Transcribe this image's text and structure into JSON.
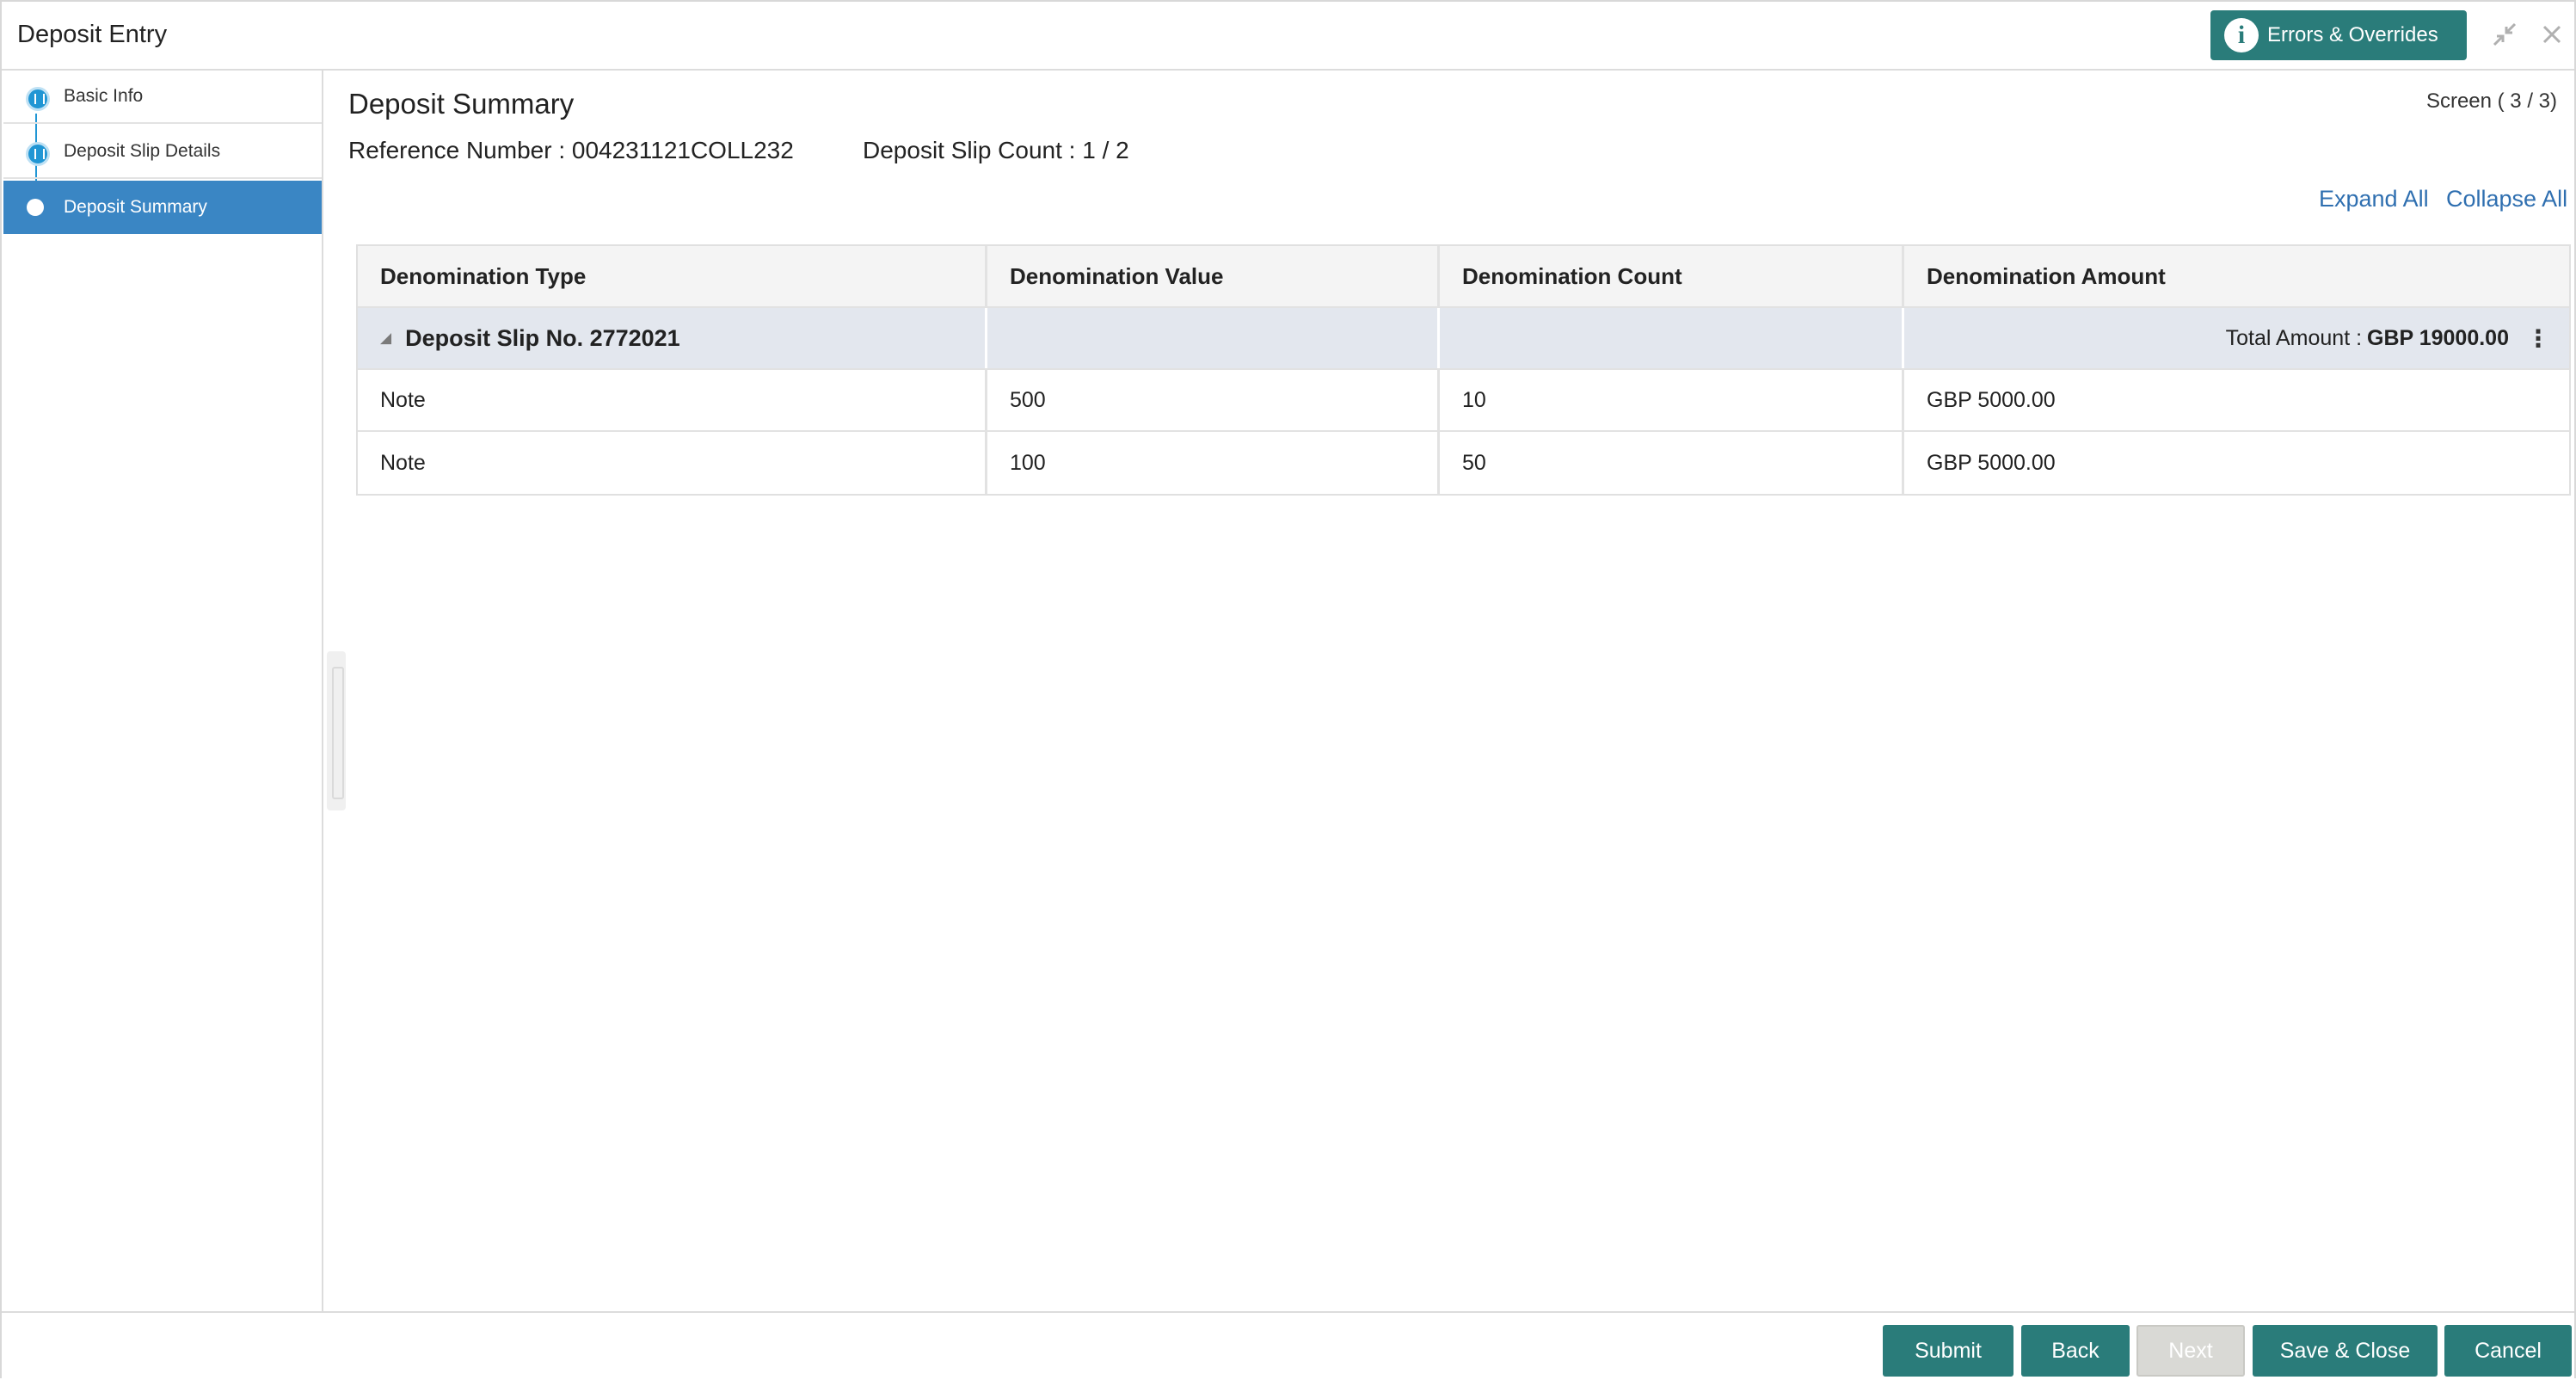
{
  "header": {
    "title": "Deposit Entry",
    "errors_button": "Errors & Overrides",
    "icons": [
      "info-icon",
      "minimize-icon",
      "close-icon"
    ]
  },
  "sidebar": {
    "items": [
      {
        "label": "Basic Info",
        "state": "visited"
      },
      {
        "label": "Deposit Slip Details",
        "state": "visited"
      },
      {
        "label": "Deposit Summary",
        "state": "active"
      }
    ]
  },
  "main": {
    "title": "Deposit Summary",
    "screen_count": "Screen ( 3 / 3)",
    "reference": "Reference Number : 004231121COLL232",
    "slip_count": "Deposit Slip Count : 1 / 2",
    "expand_all": "Expand All",
    "collapse_all": "Collapse All"
  },
  "table": {
    "columns": [
      "Denomination Type",
      "Denomination Value",
      "Denomination Count",
      "Denomination Amount"
    ],
    "group": {
      "title": "Deposit Slip No. 2772021",
      "total_label": "Total Amount :",
      "total_amount": "GBP 19000.00"
    },
    "rows": [
      [
        "Note",
        "500",
        "10",
        "GBP 5000.00"
      ],
      [
        "Note",
        "100",
        "50",
        "GBP 5000.00"
      ]
    ]
  },
  "footer": {
    "submit": "Submit",
    "back": "Back",
    "next": "Next",
    "save_close": "Save & Close",
    "cancel": "Cancel"
  },
  "colors": {
    "accent": "#2a7c7a",
    "sidebar_active": "#3a86c4",
    "link": "#2f6fb0",
    "step": "#2196d4"
  }
}
